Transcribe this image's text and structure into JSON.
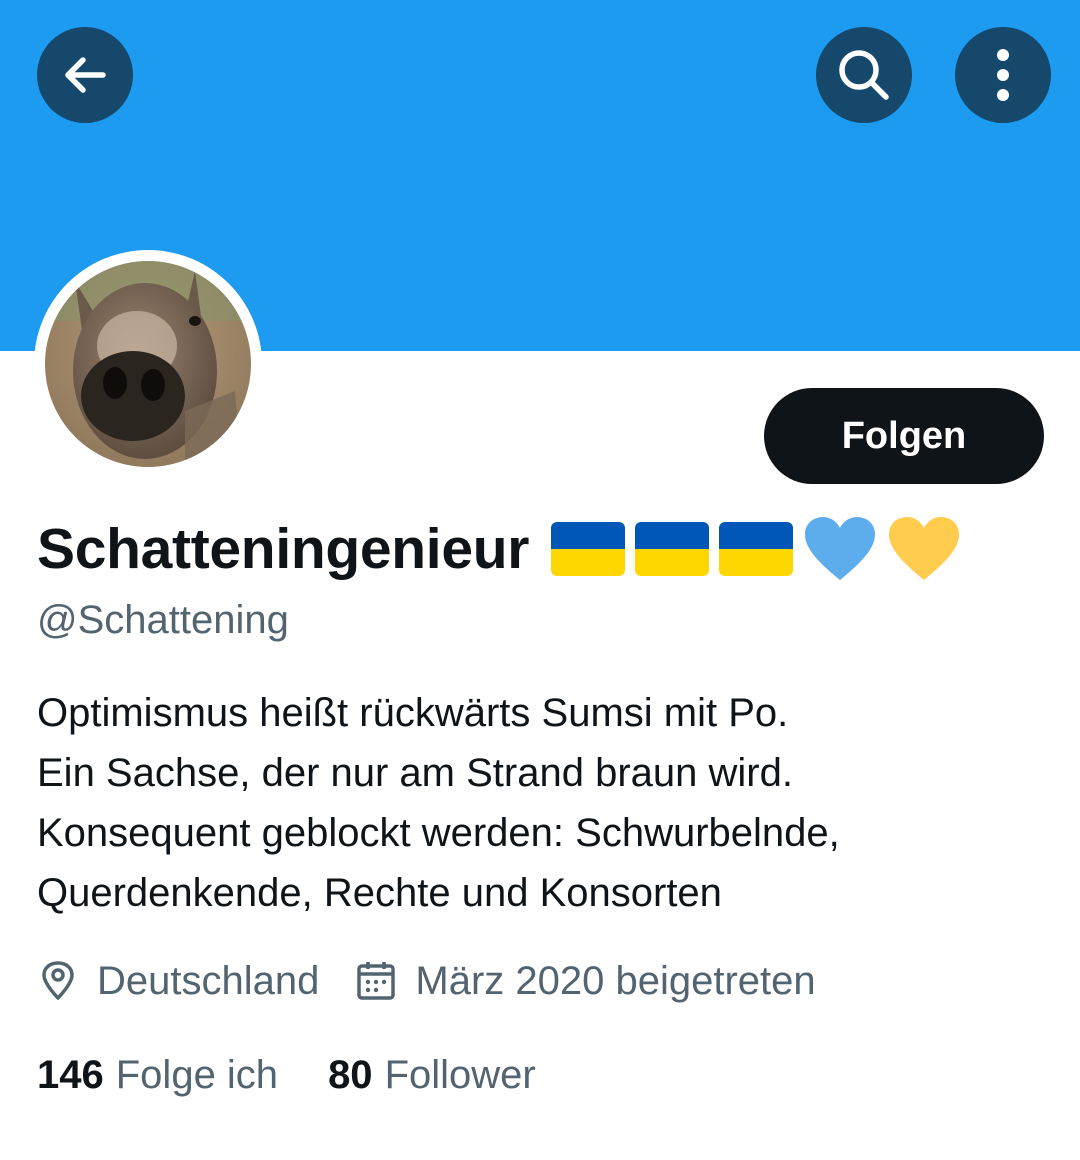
{
  "profile": {
    "display_name": "Schatteningenieur",
    "handle": "@Schattening",
    "follow_label": "Folgen",
    "bio_lines": [
      "Optimismus heißt rückwärts Sumsi mit Po.",
      "Ein Sachse, der nur am Strand braun wird.",
      "Konsequent geblockt werden: Schwurbelnde,",
      "Querdenkende, Rechte und Konsorten"
    ],
    "name_emojis": [
      "ukraine-flag",
      "ukraine-flag",
      "ukraine-flag",
      "blue-heart",
      "yellow-heart"
    ],
    "location": "Deutschland",
    "joined": "März 2020 beigetreten",
    "stats": {
      "following_count": "146",
      "following_label": "Folge ich",
      "followers_count": "80",
      "followers_label": "Follower"
    }
  },
  "header": {
    "back_icon": "arrow-left-icon",
    "search_icon": "search-icon",
    "more_icon": "more-vertical-icon"
  },
  "colors": {
    "banner": "#1d9bf0",
    "header_button": "#15486b",
    "follow_button": "#0f1419",
    "secondary_text": "#536471",
    "flag_blue": "#0057b8",
    "flag_yellow": "#ffd700",
    "heart_blue": "#5dadec",
    "heart_yellow": "#ffcc4d"
  }
}
